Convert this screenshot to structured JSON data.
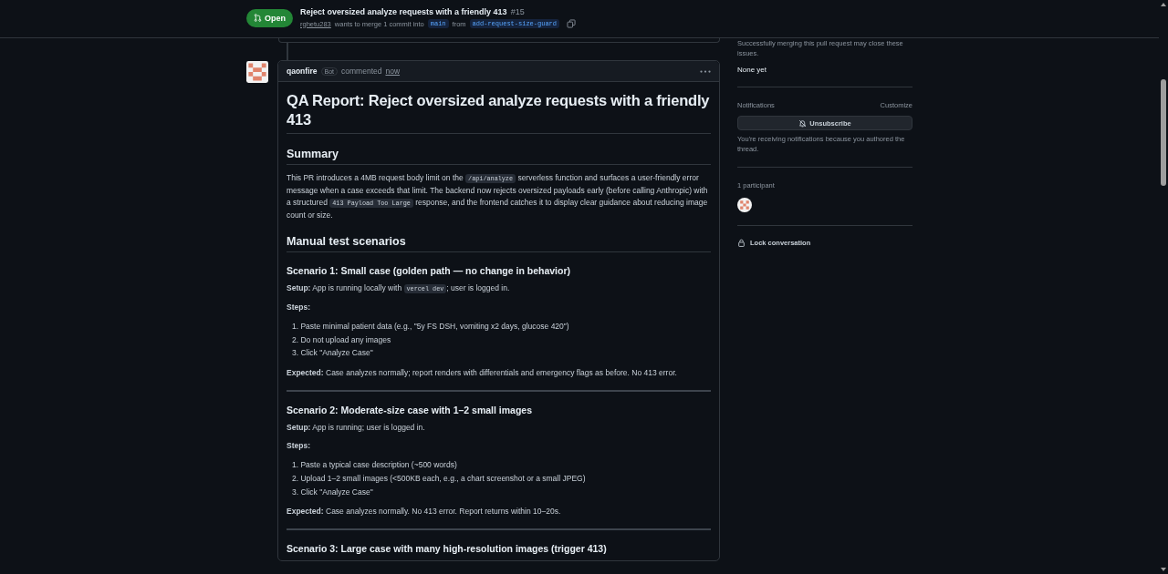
{
  "header": {
    "state": "Open",
    "title": "Reject oversized analyze requests with a friendly 413",
    "number": "#15",
    "author": "rghetu283",
    "merge_text": "wants to merge 1 commit into",
    "base_branch": "main",
    "from_text": "from",
    "head_branch": "add-request-size-guard"
  },
  "comment": {
    "author": "qaonfire",
    "badge": "Bot",
    "action": "commented",
    "time": "now",
    "blocks": [
      {
        "kind": "h1",
        "text": "QA Report: Reject oversized analyze requests with a friendly 413"
      },
      {
        "kind": "h2",
        "text": "Summary"
      },
      {
        "kind": "p",
        "parts": [
          {
            "kind": "text",
            "text": "This PR introduces a 4MB request body limit on the "
          },
          {
            "kind": "code",
            "text": "/api/analyze"
          },
          {
            "kind": "text",
            "text": " serverless function and surfaces a user-friendly error message when a case exceeds that limit. The backend now rejects oversized payloads early (before calling Anthropic) with a structured "
          },
          {
            "kind": "code",
            "text": "413 Payload Too Large"
          },
          {
            "kind": "text",
            "text": " response, and the frontend catches it to display clear guidance about reducing image count or size."
          }
        ]
      },
      {
        "kind": "h2",
        "text": "Manual test scenarios"
      },
      {
        "kind": "h3",
        "text": "Scenario 1: Small case (golden path — no change in behavior)"
      },
      {
        "kind": "p",
        "parts": [
          {
            "kind": "text",
            "text": "**Setup:** App is running locally with "
          },
          {
            "kind": "code",
            "text": "vercel dev"
          },
          {
            "kind": "text",
            "text": "; user is logged in."
          }
        ]
      },
      {
        "kind": "label",
        "text": "Steps:"
      },
      {
        "kind": "list",
        "items": [
          "1. Paste minimal patient data (e.g., \"5y FS DSH, vomiting x2 days, glucose 420\")",
          "2. Do not upload any images",
          "3. Click \"Analyze Case\""
        ]
      },
      {
        "kind": "p",
        "parts": [
          {
            "kind": "text",
            "text": "**Expected:** Case analyzes normally; report renders with differentials and emergency flags as before. No 413 error."
          }
        ]
      },
      {
        "kind": "hr"
      },
      {
        "kind": "h3",
        "text": "Scenario 2: Moderate-size case with 1–2 small images"
      },
      {
        "kind": "p",
        "parts": [
          {
            "kind": "text",
            "text": "**Setup:** App is running; user is logged in."
          }
        ]
      },
      {
        "kind": "label",
        "text": "Steps:"
      },
      {
        "kind": "list",
        "items": [
          "1. Paste a typical case description (~500 words)",
          "2. Upload 1–2 small images (<500KB each, e.g., a chart screenshot or a small JPEG)",
          "3. Click \"Analyze Case\""
        ]
      },
      {
        "kind": "p",
        "parts": [
          {
            "kind": "text",
            "text": "**Expected:** Case analyzes normally. No 413 error. Report returns within 10–20s."
          }
        ]
      },
      {
        "kind": "hr"
      },
      {
        "kind": "h3",
        "text": "Scenario 3: Large case with many high-resolution images (trigger 413)"
      }
    ]
  },
  "sidebar": {
    "issues_text": "Successfully merging this pull request may close these issues.",
    "issues_value": "None yet",
    "notifications_label": "Notifications",
    "customize": "Customize",
    "unsubscribe": "Unsubscribe",
    "notify_reason": "You're receiving notifications because you authored the thread.",
    "participants": "1 participant",
    "lock": "Lock conversation"
  }
}
